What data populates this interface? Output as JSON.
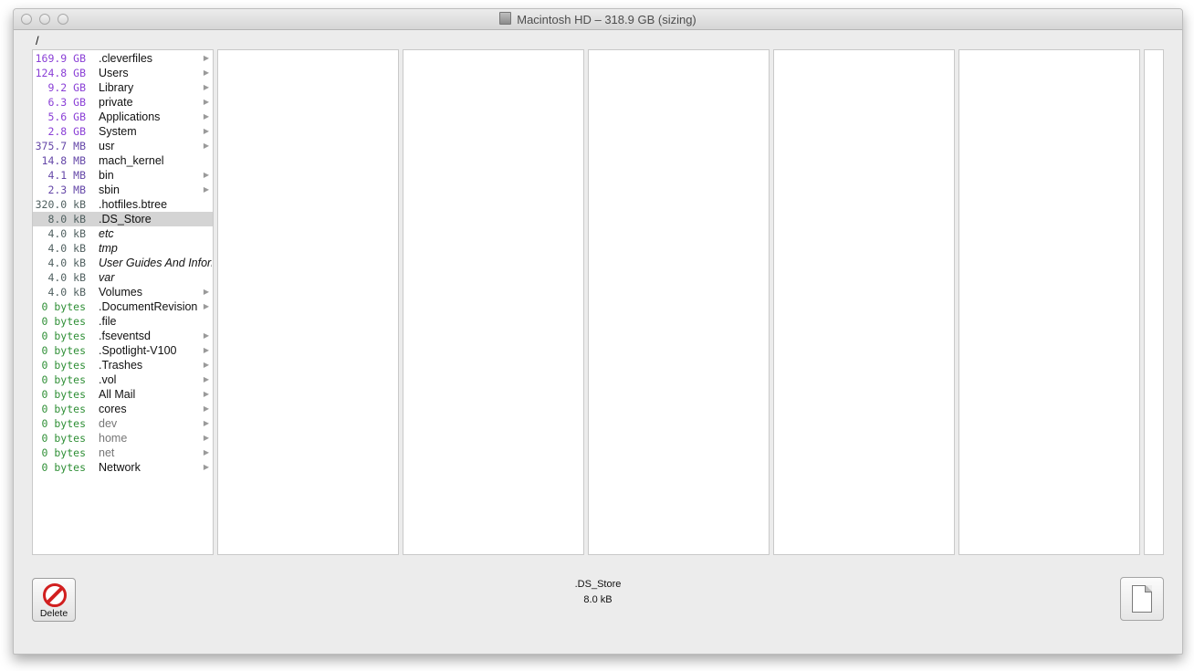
{
  "window": {
    "title": "Macintosh HD – 318.9 GB (sizing)",
    "path": "/"
  },
  "column1": {
    "items": [
      {
        "size": "169.9 GB",
        "unit": "gb",
        "name": ".cleverfiles",
        "arrow": true
      },
      {
        "size": "124.8 GB",
        "unit": "gb",
        "name": "Users",
        "arrow": true
      },
      {
        "size": "9.2 GB",
        "unit": "gb",
        "name": "Library",
        "arrow": true
      },
      {
        "size": "6.3 GB",
        "unit": "gb",
        "name": "private",
        "arrow": true
      },
      {
        "size": "5.6 GB",
        "unit": "gb",
        "name": "Applications",
        "arrow": true
      },
      {
        "size": "2.8 GB",
        "unit": "gb",
        "name": "System",
        "arrow": true
      },
      {
        "size": "375.7 MB",
        "unit": "mb",
        "name": "usr",
        "arrow": true
      },
      {
        "size": "14.8 MB",
        "unit": "mb",
        "name": "mach_kernel",
        "arrow": false
      },
      {
        "size": "4.1 MB",
        "unit": "mb",
        "name": "bin",
        "arrow": true
      },
      {
        "size": "2.3 MB",
        "unit": "mb",
        "name": "sbin",
        "arrow": true
      },
      {
        "size": "320.0 kB",
        "unit": "kb",
        "name": ".hotfiles.btree",
        "arrow": false
      },
      {
        "size": "8.0 kB",
        "unit": "kb",
        "name": ".DS_Store",
        "arrow": false,
        "selected": true
      },
      {
        "size": "4.0 kB",
        "unit": "kb",
        "name": "etc",
        "arrow": false,
        "italic": true
      },
      {
        "size": "4.0 kB",
        "unit": "kb",
        "name": "tmp",
        "arrow": false,
        "italic": true
      },
      {
        "size": "4.0 kB",
        "unit": "kb",
        "name": "User Guides And Inforr",
        "arrow": false,
        "italic": true
      },
      {
        "size": "4.0 kB",
        "unit": "kb",
        "name": "var",
        "arrow": false,
        "italic": true
      },
      {
        "size": "4.0 kB",
        "unit": "kb",
        "name": "Volumes",
        "arrow": true
      },
      {
        "size": "0 bytes",
        "unit": "bytes",
        "name": ".DocumentRevision",
        "arrow": true
      },
      {
        "size": "0 bytes",
        "unit": "bytes",
        "name": ".file",
        "arrow": false
      },
      {
        "size": "0 bytes",
        "unit": "bytes",
        "name": ".fseventsd",
        "arrow": true
      },
      {
        "size": "0 bytes",
        "unit": "bytes",
        "name": ".Spotlight-V100",
        "arrow": true
      },
      {
        "size": "0 bytes",
        "unit": "bytes",
        "name": ".Trashes",
        "arrow": true
      },
      {
        "size": "0 bytes",
        "unit": "bytes",
        "name": ".vol",
        "arrow": true
      },
      {
        "size": "0 bytes",
        "unit": "bytes",
        "name": "All Mail",
        "arrow": true
      },
      {
        "size": "0 bytes",
        "unit": "bytes",
        "name": "cores",
        "arrow": true
      },
      {
        "size": "0 bytes",
        "unit": "bytes",
        "name": "dev",
        "arrow": true,
        "dim": true
      },
      {
        "size": "0 bytes",
        "unit": "bytes",
        "name": "home",
        "arrow": true,
        "dim": true
      },
      {
        "size": "0 bytes",
        "unit": "bytes",
        "name": "net",
        "arrow": true,
        "dim": true
      },
      {
        "size": "0 bytes",
        "unit": "bytes",
        "name": "Network",
        "arrow": true
      }
    ]
  },
  "bottom": {
    "delete_label": "Delete",
    "selected_name": ".DS_Store",
    "selected_size": "8.0 kB"
  },
  "icons": {
    "arrow_glyph": "▶"
  },
  "colors": {
    "gb": "#8a3fd6",
    "mb": "#6547a8",
    "kb": "#4f5f5f",
    "bytes": "#2f8f36"
  }
}
